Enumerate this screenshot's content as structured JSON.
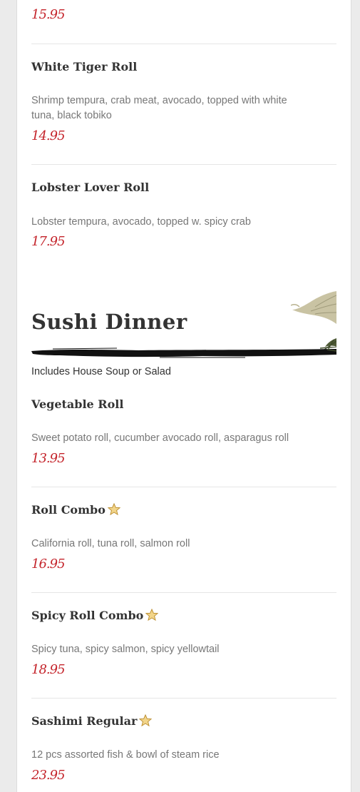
{
  "top_item": {
    "price": "15.95"
  },
  "items_before": [
    {
      "name": "White Tiger Roll",
      "description": "Shrimp tempura, crab meat, avocado, topped with white tuna, black tobiko",
      "price": "14.95"
    },
    {
      "name": "Lobster Lover Roll",
      "description": "Lobster tempura, avocado, topped w. spicy crab",
      "price": "17.95"
    }
  ],
  "section": {
    "title": "Sushi Dinner",
    "note": "Includes House Soup or Salad"
  },
  "items": [
    {
      "name": "Vegetable Roll",
      "description": "Sweet potato roll, cucumber avocado roll, asparagus roll",
      "price": "13.95",
      "featured": false
    },
    {
      "name": "Roll Combo",
      "description": "California roll, tuna roll, salmon roll",
      "price": "16.95",
      "featured": true
    },
    {
      "name": "Spicy Roll Combo",
      "description": "Spicy tuna, spicy salmon, spicy yellowtail",
      "price": "18.95",
      "featured": true
    },
    {
      "name": "Sashimi Regular",
      "description": "12 pcs assorted fish & bowl of steam rice",
      "price": "23.95",
      "featured": true
    }
  ],
  "colors": {
    "price": "#c4242b",
    "heading": "#333333",
    "description": "#777777",
    "star": "#e8b93a"
  },
  "icons": {
    "featured": "star-icon",
    "decoration": "bamboo-leaf-icon",
    "underline": "brush-stroke"
  }
}
